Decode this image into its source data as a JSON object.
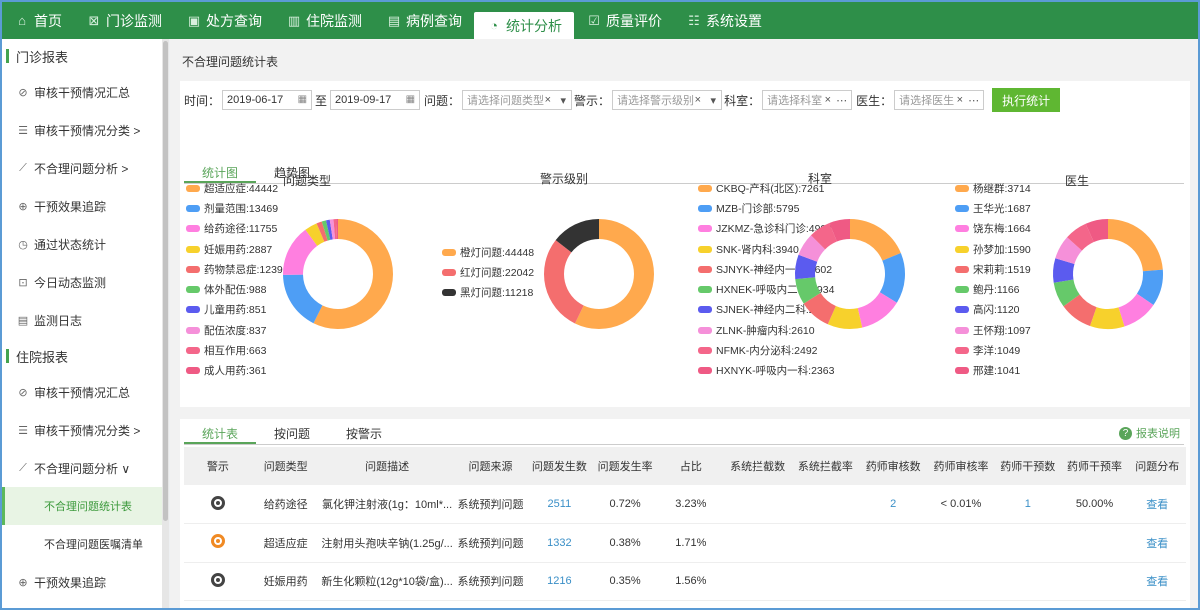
{
  "nav": {
    "items": [
      {
        "icon": "home-icon",
        "glyph": "⌂",
        "label": "首页"
      },
      {
        "icon": "monitor-icon",
        "glyph": "⊠",
        "label": "门诊监测"
      },
      {
        "icon": "prescription-icon",
        "glyph": "▣",
        "label": "处方查询"
      },
      {
        "icon": "inpatient-icon",
        "glyph": "▥",
        "label": "住院监测"
      },
      {
        "icon": "case-icon",
        "glyph": "▤",
        "label": "病例查询"
      },
      {
        "icon": "stats-icon",
        "glyph": "◔",
        "label": "统计分析",
        "active": true
      },
      {
        "icon": "quality-icon",
        "glyph": "☑",
        "label": "质量评价"
      },
      {
        "icon": "settings-icon",
        "glyph": "☷",
        "label": "系统设置"
      }
    ]
  },
  "sidebar": {
    "group1": "门诊报表",
    "items1": [
      {
        "icon": "check-icon",
        "glyph": "⊘",
        "label": "审核干预情况汇总"
      },
      {
        "icon": "list-icon",
        "glyph": "☰",
        "label": "审核干预情况分类 >"
      },
      {
        "icon": "chart-line-icon",
        "glyph": "⟋",
        "label": "不合理问题分析 >"
      },
      {
        "icon": "target-icon",
        "glyph": "⊕",
        "label": "干预效果追踪"
      },
      {
        "icon": "clock-icon",
        "glyph": "◷",
        "label": "通过状态统计"
      },
      {
        "icon": "image-icon",
        "glyph": "⊡",
        "label": "今日动态监测"
      },
      {
        "icon": "log-icon",
        "glyph": "▤",
        "label": "监测日志"
      }
    ],
    "group2": "住院报表",
    "items2": [
      {
        "icon": "check-icon",
        "glyph": "⊘",
        "label": "审核干预情况汇总"
      },
      {
        "icon": "list-icon",
        "glyph": "☰",
        "label": "审核干预情况分类 >"
      },
      {
        "icon": "chart-line-icon",
        "glyph": "⟋",
        "label": "不合理问题分析 ∨"
      }
    ],
    "sub_active": "不合理问题统计表",
    "sub2": "不合理问题医嘱清单",
    "last": {
      "icon": "target-icon",
      "glyph": "⊕",
      "label": "干预效果追踪"
    }
  },
  "page_title": "不合理问题统计表",
  "filters": {
    "time_label": "时间：",
    "start_date": "2019-06-17",
    "to_label": "至",
    "end_date": "2019-09-17",
    "problem_label": "问题：",
    "problem_ph": "请选择问题类型",
    "warn_label": "警示：",
    "warn_ph": "请选择警示级别",
    "dept_label": "科室：",
    "dept_ph": "请选择科室",
    "doctor_label": "医生：",
    "doctor_ph": "请选择医生",
    "run_btn": "执行统计",
    "clear_glyph": "×",
    "more_glyph": "⋯",
    "down_glyph": "▾",
    "cal_glyph": "▦"
  },
  "chart_tabs": [
    "统计图",
    "趋势图"
  ],
  "chart_data": [
    {
      "type": "pie",
      "title": "问题类型",
      "categories": [
        "超适应症",
        "剂量范围",
        "给药途径",
        "妊娠用药",
        "药物禁忌症",
        "体外配伍",
        "儿童用药",
        "配伍浓度",
        "相互作用",
        "成人用药"
      ],
      "values": [
        44442,
        13469,
        11755,
        2887,
        1239,
        988,
        851,
        837,
        663,
        361
      ],
      "legend": [
        "超适应症:44442",
        "剂量范围:13469",
        "给药途径:11755",
        "妊娠用药:2887",
        "药物禁忌症:1239",
        "体外配伍:988",
        "儿童用药:851",
        "配伍浓度:837",
        "相互作用:663",
        "成人用药:361"
      ],
      "colors": [
        "#ffa94d",
        "#4e9ef5",
        "#ff7fe0",
        "#f7d12c",
        "#f46e6e",
        "#66c96a",
        "#5b5bef",
        "#f590d9",
        "#f4668a",
        "#ef5a84"
      ]
    },
    {
      "type": "pie",
      "title": "警示级别",
      "categories": [
        "橙灯问题",
        "红灯问题",
        "黑灯问题"
      ],
      "values": [
        44448,
        22042,
        11218
      ],
      "legend": [
        "橙灯问题:44448",
        "红灯问题:22042",
        "黑灯问题:11218"
      ],
      "colors": [
        "#ffa94d",
        "#f46e6e",
        "#333333"
      ]
    },
    {
      "type": "pie",
      "title": "科室",
      "categories": [
        "CKBQ-产科(北区)",
        "MZB-门诊部",
        "JZKMZ-急诊科门诊",
        "SNK-肾内科",
        "SJNYK-神经内一科",
        "HXNEK-呼吸内二科",
        "SJNEK-神经内二科",
        "ZLNK-肿瘤内科",
        "NFMK-内分泌科",
        "HXNYK-呼吸内一科"
      ],
      "values": [
        7261,
        5795,
        4903,
        3940,
        3602,
        2934,
        2778,
        2610,
        2492,
        2363
      ],
      "legend": [
        "CKBQ-产科(北区):7261",
        "MZB-门诊部:5795",
        "JZKMZ-急诊科门诊:4903",
        "SNK-肾内科:3940",
        "SJNYK-神经内一科:3602",
        "HXNEK-呼吸内二科:2934",
        "SJNEK-神经内二科:2778",
        "ZLNK-肿瘤内科:2610",
        "NFMK-内分泌科:2492",
        "HXNYK-呼吸内一科:2363"
      ],
      "colors": [
        "#ffa94d",
        "#4e9ef5",
        "#ff7fe0",
        "#f7d12c",
        "#f46e6e",
        "#66c96a",
        "#5b5bef",
        "#f590d9",
        "#f4668a",
        "#ef5a84"
      ]
    },
    {
      "type": "pie",
      "title": "医生",
      "categories": [
        "杨继群",
        "王华光",
        "饶东梅",
        "孙梦加",
        "宋莉莉",
        "鲍丹",
        "高闪",
        "王怀翔",
        "李洋",
        "邢建"
      ],
      "values": [
        3714,
        1687,
        1664,
        1590,
        1519,
        1166,
        1120,
        1097,
        1049,
        1041
      ],
      "legend": [
        "杨继群:3714",
        "王华光:1687",
        "饶东梅:1664",
        "孙梦加:1590",
        "宋莉莉:1519",
        "鲍丹:1166",
        "高闪:1120",
        "王怀翔:1097",
        "李洋:1049",
        "邢建:1041"
      ],
      "colors": [
        "#ffa94d",
        "#4e9ef5",
        "#ff7fe0",
        "#f7d12c",
        "#f46e6e",
        "#66c96a",
        "#5b5bef",
        "#f590d9",
        "#f4668a",
        "#ef5a84"
      ]
    }
  ],
  "table_tabs": [
    "统计表",
    "按问题",
    "按警示"
  ],
  "help_label": "报表说明",
  "table": {
    "headers": [
      "警示",
      "问题类型",
      "问题描述",
      "问题来源",
      "问题发生数",
      "问题发生率",
      "占比",
      "系统拦截数",
      "系统拦截率",
      "药师审核数",
      "药师审核率",
      "药师干预数",
      "药师干预率",
      "问题分布"
    ],
    "rows": [
      {
        "warn": "black",
        "type": "给药途径",
        "desc": "氯化钾注射液(1g：10ml*...",
        "source": "系统预判问题",
        "count": "2511",
        "rate": "0.72%",
        "share": "3.23%",
        "sys_block": "",
        "sys_rate": "",
        "ph_review": "2",
        "ph_review_rate": "< 0.01%",
        "ph_int": "1",
        "ph_int_rate": "50.00%",
        "dist": "查看"
      },
      {
        "warn": "orange",
        "type": "超适应症",
        "desc": "注射用头孢呋辛钠(1.25g/...",
        "source": "系统预判问题",
        "count": "1332",
        "rate": "0.38%",
        "share": "1.71%",
        "sys_block": "",
        "sys_rate": "",
        "ph_review": "",
        "ph_review_rate": "",
        "ph_int": "",
        "ph_int_rate": "",
        "dist": "查看"
      },
      {
        "warn": "black",
        "type": "妊娠用药",
        "desc": "新生化颗粒(12g*10袋/盒)...",
        "source": "系统预判问题",
        "count": "1216",
        "rate": "0.35%",
        "share": "1.56%",
        "sys_block": "",
        "sys_rate": "",
        "ph_review": "",
        "ph_review_rate": "",
        "ph_int": "",
        "ph_int_rate": "",
        "dist": "查看"
      }
    ]
  }
}
